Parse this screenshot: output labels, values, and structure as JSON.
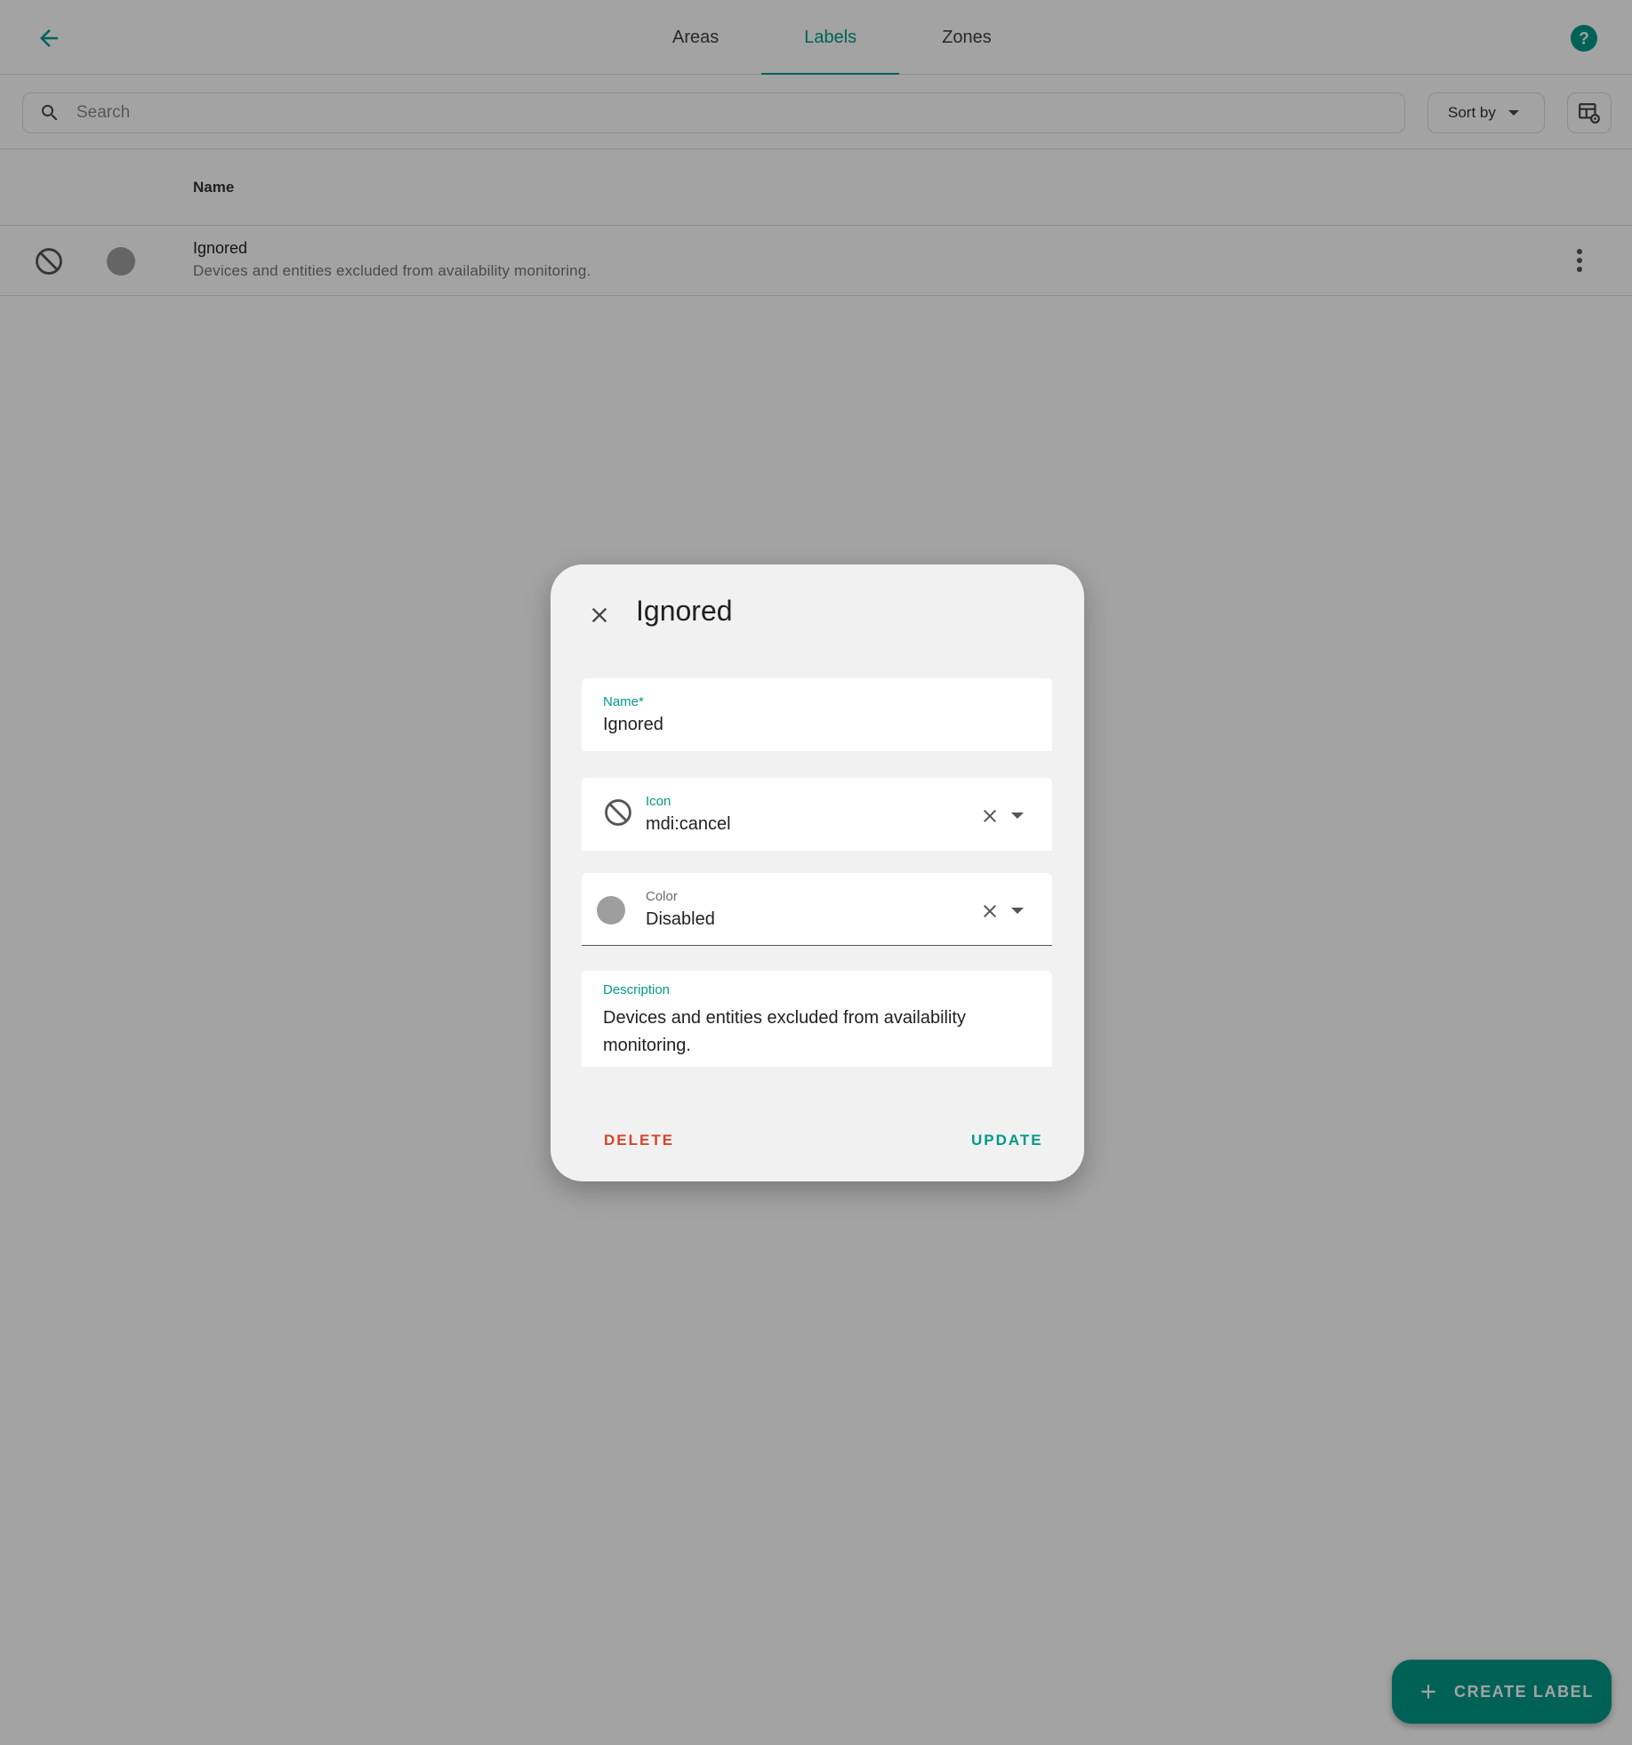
{
  "header": {
    "tabs": [
      {
        "label": "Areas",
        "active": false
      },
      {
        "label": "Labels",
        "active": true
      },
      {
        "label": "Zones",
        "active": false
      }
    ]
  },
  "toolbar": {
    "search_placeholder": "Search",
    "sort_label": "Sort by"
  },
  "table": {
    "columns": [
      "Name"
    ],
    "rows": [
      {
        "icon": "cancel-icon",
        "color": "#9e9e9e",
        "name": "Ignored",
        "description": "Devices and entities excluded from availability monitoring."
      }
    ]
  },
  "fab": {
    "label": "CREATE LABEL"
  },
  "dialog": {
    "title": "Ignored",
    "name_label": "Name*",
    "name_value": "Ignored",
    "icon_label": "Icon",
    "icon_value": "mdi:cancel",
    "color_label": "Color",
    "color_value": "Disabled",
    "description_label": "Description",
    "description_value": "Devices and entities excluded from availability monitoring.",
    "delete_label": "DELETE",
    "update_label": "UPDATE"
  },
  "colors": {
    "accent": "#009a88",
    "danger": "#d8432a",
    "disabled_color": "#9e9e9e"
  }
}
